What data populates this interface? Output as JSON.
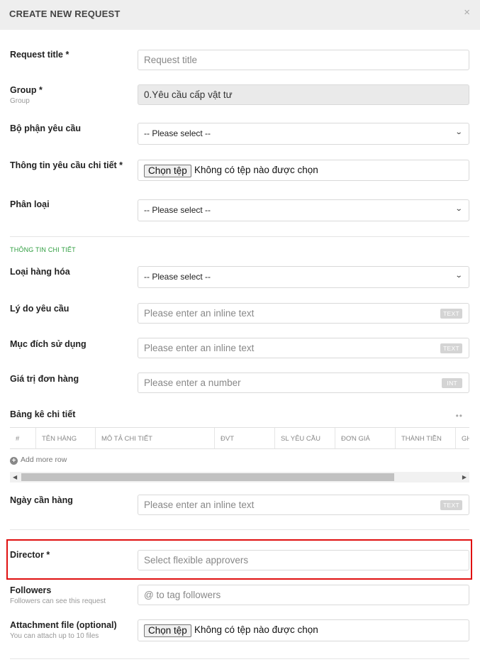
{
  "header": {
    "title": "CREATE NEW REQUEST",
    "close": "×"
  },
  "request_title": {
    "label": "Request title *",
    "placeholder": "Request title"
  },
  "group": {
    "label": "Group *",
    "sublabel": "Group",
    "value": "0.Yêu cầu cấp vật tư"
  },
  "department": {
    "label": "Bộ phận yêu cầu",
    "value": "-- Please select --"
  },
  "detail_info": {
    "label": "Thông tin yêu cầu chi tiết *",
    "button": "Chọn tệp",
    "status": "Không có tệp nào được chọn"
  },
  "category": {
    "label": "Phân loại",
    "value": "-- Please select --"
  },
  "section": {
    "title": "THÔNG TIN CHI TIẾT"
  },
  "goods_type": {
    "label": "Loại hàng hóa",
    "value": "-- Please select --"
  },
  "reason": {
    "label": "Lý do yêu cầu",
    "placeholder": "Please enter an inline text",
    "badge": "TEXT"
  },
  "purpose": {
    "label": "Mục đích sử dụng",
    "placeholder": "Please enter an inline text",
    "badge": "TEXT"
  },
  "order_value": {
    "label": "Giá trị đơn hàng",
    "placeholder": "Please enter a number",
    "badge": "INT"
  },
  "table": {
    "label": "Bảng kê chi tiết",
    "more": "••",
    "columns": [
      "#",
      "TÊN HÀNG",
      "MÔ TẢ CHI TIẾT",
      "ĐVT",
      "SL YÊU CẦU",
      "ĐƠN GIÁ",
      "THÀNH TIỀN",
      "GH"
    ],
    "add_row": "Add more row"
  },
  "need_date": {
    "label": "Ngày cần hàng",
    "placeholder": "Please enter an inline text",
    "badge": "TEXT"
  },
  "director": {
    "label": "Director *",
    "placeholder": "Select flexible approvers"
  },
  "followers": {
    "label": "Followers",
    "sublabel": "Followers can see this request",
    "placeholder": "@ to tag followers"
  },
  "attachment": {
    "label": "Attachment file (optional)",
    "sublabel": "You can attach up to 10 files",
    "button": "Chọn tệp",
    "status": "Không có tệp nào được chọn"
  },
  "colors": {
    "highlight": "#e01010",
    "section": "#2e9e3f",
    "header_bg": "#eeeeee"
  },
  "icons": {
    "close": "close-icon",
    "chevron": "chevron-down-icon",
    "plus": "plus-circle-icon",
    "more": "more-icon"
  }
}
